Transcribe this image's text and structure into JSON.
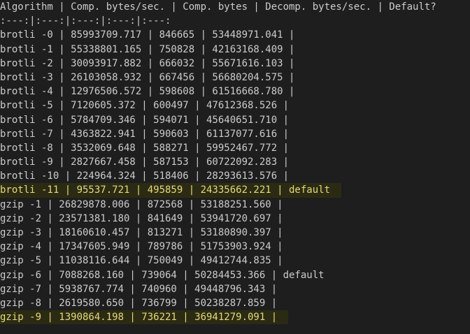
{
  "colors": {
    "background": "#1e1e1e",
    "foreground": "#cccccc",
    "highlight_background": "#2b2b14",
    "highlight_foreground": "#e6db74"
  },
  "lines": [
    "Algorithm | Comp. bytes/sec. | Comp. bytes | Decomp. bytes/sec. | Default?",
    ":---:|:---:|:---:|:---:|:---:",
    "brotli -0 | 85993709.717 | 846665 | 53448971.041 |",
    "brotli -1 | 55338801.165 | 750828 | 42163168.409 |",
    "brotli -2 | 30093917.882 | 666032 | 55671616.103 |",
    "brotli -3 | 26103058.932 | 667456 | 56680204.575 |",
    "brotli -4 | 12976506.572 | 598608 | 61516668.780 |",
    "brotli -5 | 7120605.372 | 600497 | 47612368.526 |",
    "brotli -6 | 5784709.346 | 594071 | 45640651.710 |",
    "brotli -7 | 4363822.941 | 590603 | 61137077.616 |",
    "brotli -8 | 3532069.648 | 588271 | 59952467.772 |",
    "brotli -9 | 2827667.458 | 587153 | 60722092.283 |",
    "brotli -10 | 224964.324 | 518406 | 28293613.576 |",
    "brotli -11 | 95537.721 | 495859 | 24335662.221 | default",
    "gzip -1 | 26829878.006 | 872568 | 53188251.560 |",
    "gzip -2 | 23571381.180 | 841649 | 53941720.697 |",
    "gzip -3 | 18160610.457 | 813271 | 53180890.397 |",
    "gzip -4 | 17347605.949 | 789786 | 51753903.924 |",
    "gzip -5 | 11038116.644 | 750049 | 49412744.835 |",
    "gzip -6 | 7088268.160 | 739064 | 50284453.366 | default",
    "gzip -7 | 5938767.774 | 740960 | 49448796.343 |",
    "gzip -8 | 2619580.650 | 736799 | 50238287.859 |",
    "gzip -9 | 1390864.198 | 736221 | 36941279.091 |"
  ]
}
